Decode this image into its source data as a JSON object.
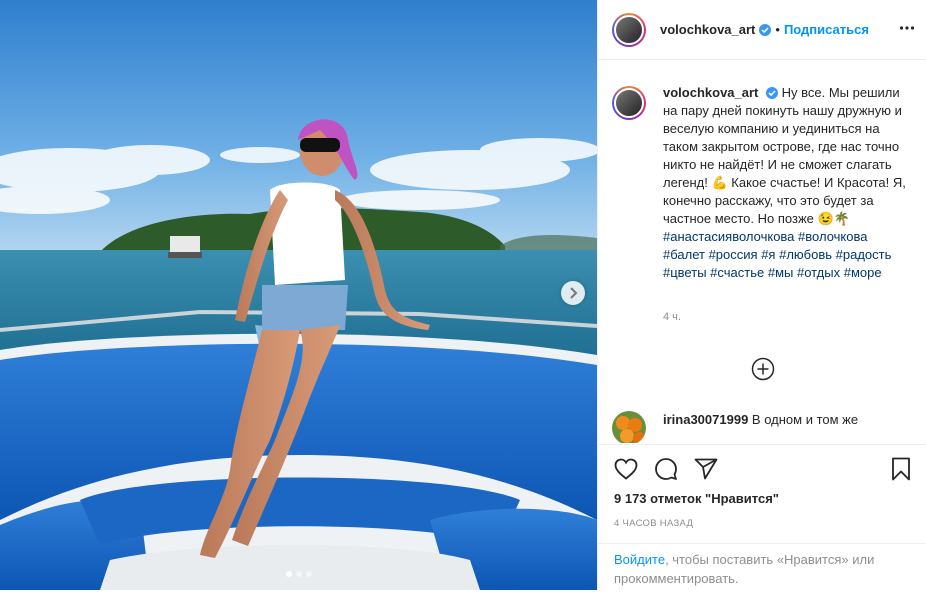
{
  "media": {
    "photo_description_icon": "beach-photo",
    "next_icon": "chevron-right-icon"
  },
  "header": {
    "username": "volochkova_art",
    "separator": "•",
    "follow_label": "Подписаться",
    "more_icon": "more-icon"
  },
  "caption": {
    "username": "volochkova_art",
    "text": "Ну все. Мы решили на пару дней покинуть нашу дружную и веселую компанию и уединиться на таком закрытом острове, где нас точно никто не найдёт! И не сможет слагать легенд! 💪 Какое счастье! И Красота! Я, конечно расскажу, что это будет за частное место. Но позже 😉🌴",
    "hashtags": [
      "#анастасияволочкова",
      "#волочкова",
      "#балет",
      "#россия",
      "#я",
      "#любовь",
      "#радость",
      "#цветы",
      "#счастье",
      "#мы",
      "#отдых",
      "#море"
    ],
    "time": "4 ч."
  },
  "comment": {
    "username": "irina30071999",
    "text": "В одном и том же"
  },
  "actions": {
    "likes": "9 173 отметок \"Нравится\"",
    "ago": "4 ЧАСОВ НАЗАД"
  },
  "login_prompt": {
    "link": "Войдите",
    "rest": ", чтобы поставить «Нравится» или прокомментировать."
  },
  "colors": {
    "accent": "#0095f6",
    "text": "#262626",
    "muted": "#8e8e8e"
  }
}
